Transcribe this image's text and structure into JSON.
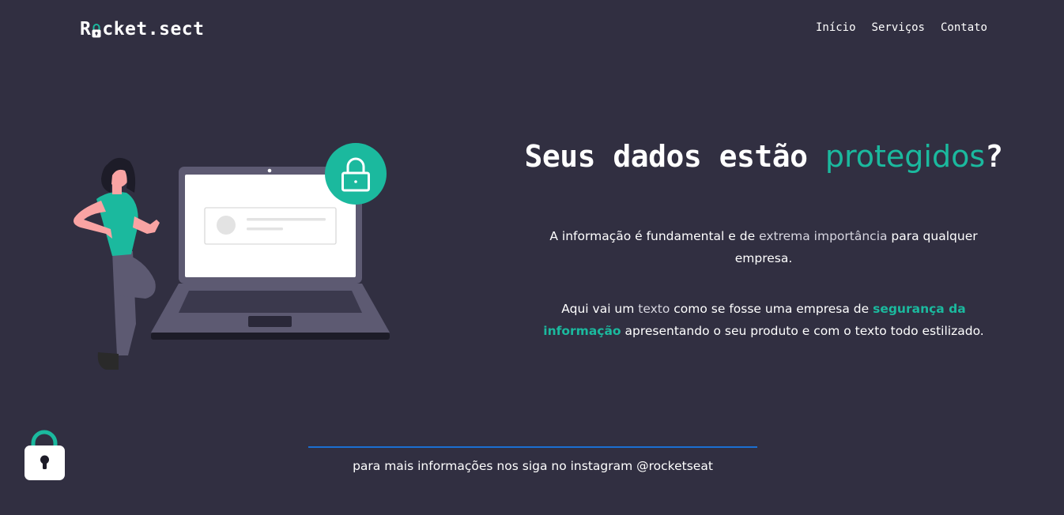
{
  "header": {
    "logo_prefix": "R",
    "logo_suffix": "cket.sect",
    "nav": [
      {
        "label": "Início"
      },
      {
        "label": "Serviços"
      },
      {
        "label": "Contato"
      }
    ]
  },
  "hero": {
    "title_main": "Seus dados estão ",
    "title_accent": "protegidos",
    "title_end": "?",
    "p1": {
      "a": "A informação é fundamental e de ",
      "b": "extrema importância",
      "c": " para qualquer empresa."
    },
    "p2": {
      "a": "Aqui vai um ",
      "b": "texto",
      "c": " como se fosse uma empresa de ",
      "d": "segurança da informação",
      "e": " apresentando o seu produto e com o texto todo estilizado."
    }
  },
  "footer": {
    "text": "para mais informações nos siga no instagram @rocketseat"
  },
  "icons": {
    "logo_lock": "lock-icon",
    "badge_lock": "lock-icon",
    "footer_lock": "lock-icon"
  },
  "colors": {
    "background": "#312F41",
    "accent": "#1BB99E",
    "divider": "#1B6FD2",
    "text": "#FFFFFF"
  }
}
